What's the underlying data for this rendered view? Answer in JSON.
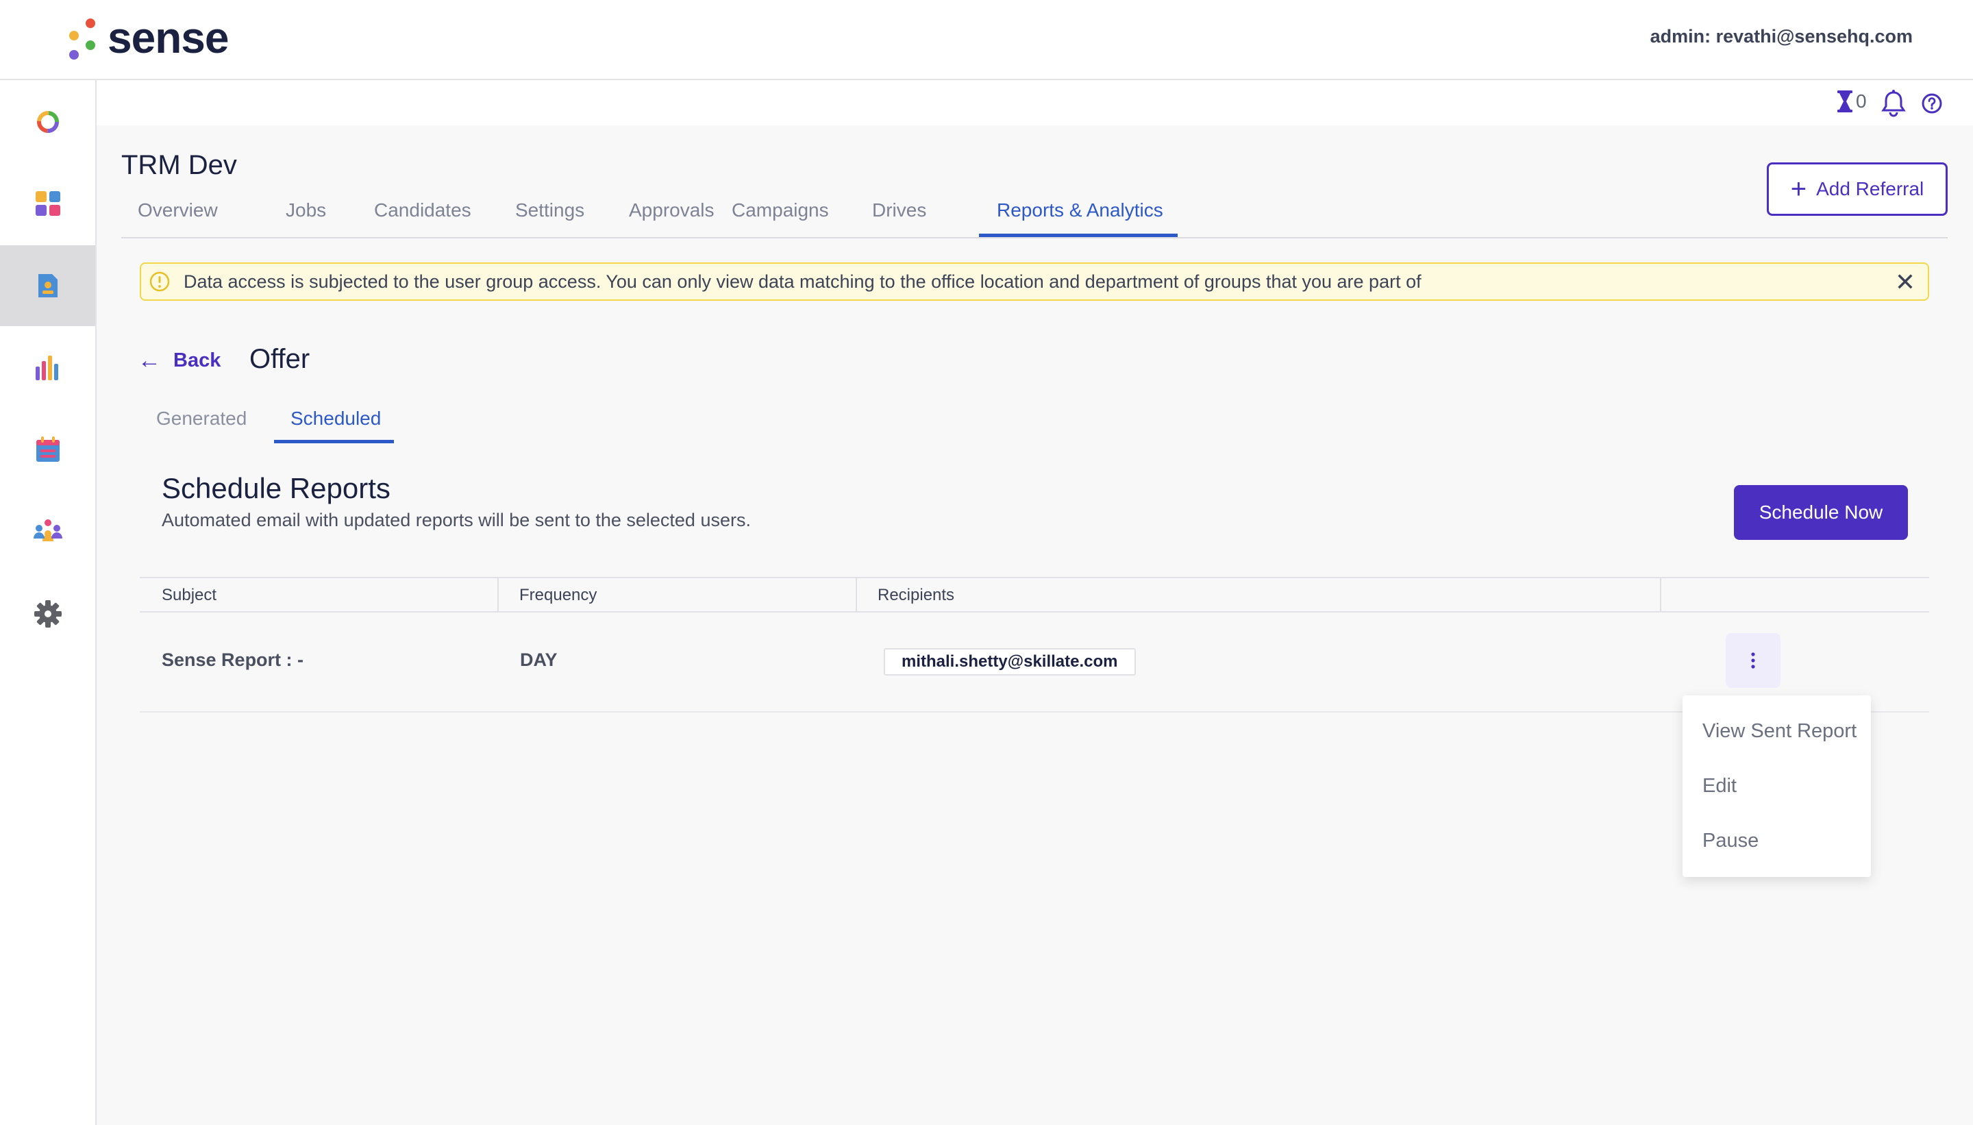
{
  "brand": {
    "name": "sense",
    "dot_colors": [
      "#e8523a",
      "#f3b23a",
      "#4fb34a",
      "#7a5cd6"
    ]
  },
  "header": {
    "admin_label": "admin: revathi@sensehq.com"
  },
  "sidebar": {
    "items": [
      {
        "icon": "donut-chart-icon"
      },
      {
        "icon": "dashboard-grid-icon"
      },
      {
        "icon": "report-document-icon",
        "active": true
      },
      {
        "icon": "analytics-bars-icon"
      },
      {
        "icon": "calendar-icon"
      },
      {
        "icon": "people-group-icon"
      },
      {
        "icon": "settings-gear-icon"
      }
    ]
  },
  "utility": {
    "hourglass_count": "0"
  },
  "page": {
    "title": "TRM Dev",
    "add_referral_label": "Add Referral",
    "tabs": [
      {
        "label": "Overview"
      },
      {
        "label": "Jobs"
      },
      {
        "label": "Candidates"
      },
      {
        "label": "Settings"
      },
      {
        "label": "Approvals"
      },
      {
        "label": "Campaigns"
      },
      {
        "label": "Drives"
      },
      {
        "label": "Reports & Analytics",
        "active": true
      }
    ]
  },
  "notice": {
    "text": "Data access is subjected to the user group access. You can only view data matching to the office location and department of groups that you are part of"
  },
  "report": {
    "back_label": "Back",
    "title": "Offer",
    "sub_tabs": [
      {
        "label": "Generated"
      },
      {
        "label": "Scheduled",
        "active": true
      }
    ],
    "schedule": {
      "title": "Schedule Reports",
      "subtitle": "Automated email with updated reports will be sent to the selected users.",
      "button_label": "Schedule Now"
    },
    "table": {
      "headers": [
        "Subject",
        "Frequency",
        "Recipients"
      ],
      "rows": [
        {
          "subject": "Sense Report : -",
          "frequency": "DAY",
          "recipients": [
            "mithali.shetty@skillate.com"
          ]
        }
      ]
    },
    "row_menu": {
      "items": [
        "View Sent Report",
        "Edit",
        "Pause"
      ]
    }
  },
  "colors": {
    "accent": "#4a2fc1",
    "tab_active": "#2d59c8",
    "notice_bg": "#fefadf",
    "notice_border": "#f1d84a"
  }
}
